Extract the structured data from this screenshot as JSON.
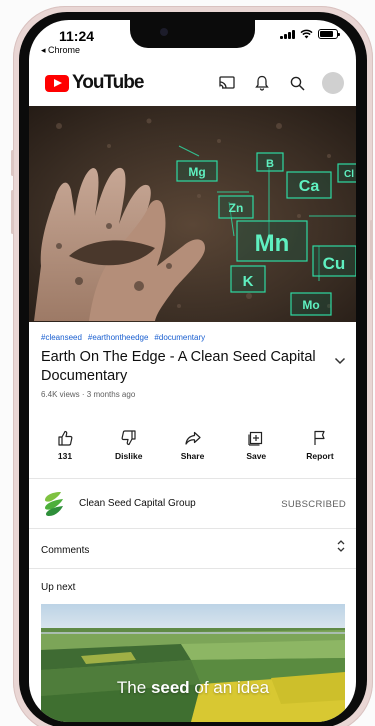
{
  "status_bar": {
    "time": "11:24",
    "back_app": "◂ Chrome"
  },
  "header": {
    "logo_text": "YouTube",
    "icons": [
      "cast-icon",
      "bell-icon",
      "search-icon",
      "avatar"
    ]
  },
  "video": {
    "element_labels": [
      "Mg",
      "B",
      "Ca",
      "Cl",
      "Zn",
      "Mn",
      "K",
      "Cu",
      "Mo"
    ],
    "accent": "#2fd9a2"
  },
  "info": {
    "hashtags": [
      "#cleanseed",
      "#earthontheedge",
      "#documentary"
    ],
    "title": "Earth On The Edge - A Clean Seed Capital Documentary",
    "meta": "6.4K views · 3 months ago"
  },
  "actions": [
    {
      "label": "131",
      "icon": "thumbs-up-icon"
    },
    {
      "label": "Dislike",
      "icon": "thumbs-down-icon"
    },
    {
      "label": "Share",
      "icon": "share-icon"
    },
    {
      "label": "Save",
      "icon": "save-icon"
    },
    {
      "label": "Report",
      "icon": "flag-icon"
    }
  ],
  "channel": {
    "name": "Clean Seed Capital Group",
    "subscribe_state": "SUBSCRIBED",
    "brand_color": "#4caf3b"
  },
  "comments": {
    "label": "Comments"
  },
  "up_next": {
    "label": "Up next",
    "caption_pre": "The ",
    "caption_bold": "seed",
    "caption_post": " of an idea"
  },
  "colors": {
    "youtube_red": "#ff0000",
    "link_blue": "#1a5fd0",
    "frame": "#e9d6d4"
  }
}
